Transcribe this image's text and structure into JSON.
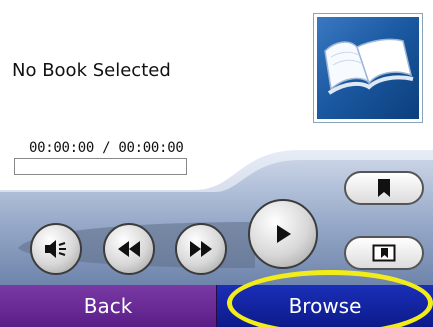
{
  "book": {
    "title": "No Book Selected",
    "time_display": "00:00:00 / 00:00:00",
    "progress_fraction": 0
  },
  "cover": {
    "icon": "open-book-icon"
  },
  "controls": {
    "volume": {
      "icon": "speaker-icon"
    },
    "rewind": {
      "icon": "rewind-icon"
    },
    "fast_forward": {
      "icon": "fast-forward-icon"
    },
    "play": {
      "icon": "play-icon"
    },
    "bookmark": {
      "icon": "bookmark-icon"
    },
    "chapters": {
      "icon": "bookmark-list-icon"
    }
  },
  "nav": {
    "back_label": "Back",
    "browse_label": "Browse"
  },
  "colors": {
    "back_button": "#5a1d86",
    "browse_button": "#0c1a8a",
    "highlight": "#f2ec1a",
    "deck": "#8fa3c4"
  }
}
